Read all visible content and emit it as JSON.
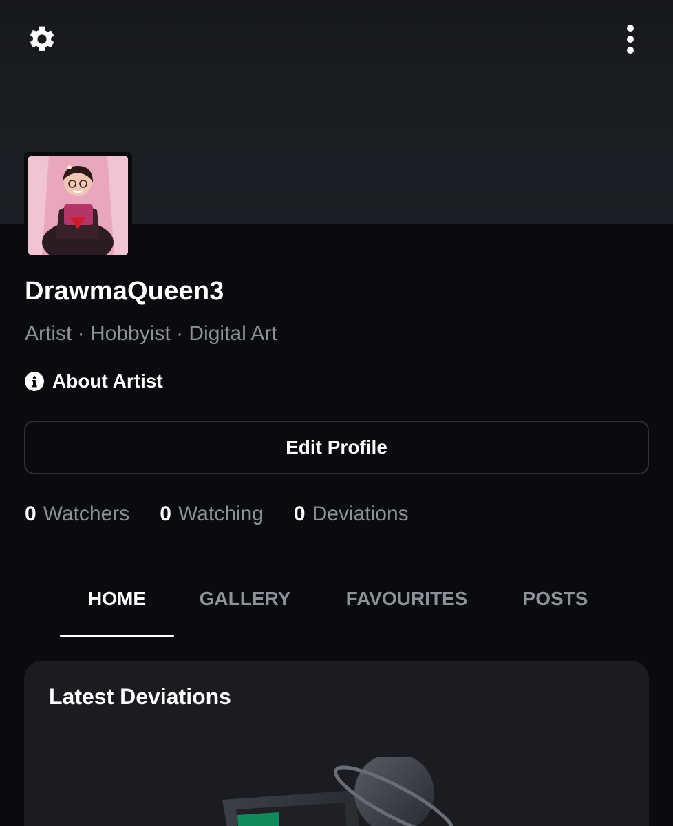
{
  "profile": {
    "username": "DrawmaQueen3",
    "tagline": "Artist · Hobbyist · Digital Art",
    "about_label": "About Artist",
    "edit_label": "Edit Profile"
  },
  "stats": [
    {
      "count": "0",
      "label": "Watchers"
    },
    {
      "count": "0",
      "label": "Watching"
    },
    {
      "count": "0",
      "label": "Deviations"
    }
  ],
  "tabs": [
    {
      "label": "HOME",
      "active": true
    },
    {
      "label": "GALLERY",
      "active": false
    },
    {
      "label": "FAVOURITES",
      "active": false
    },
    {
      "label": "POSTS",
      "active": false
    }
  ],
  "latest": {
    "title": "Latest Deviations"
  },
  "icons": {
    "settings": "gear-icon",
    "more": "more-vertical-icon",
    "info": "info-icon"
  },
  "colors": {
    "background": "#0a0b0e",
    "banner": "#1a1d22",
    "muted_text": "#8e9199",
    "card": "#1a1c21",
    "border": "#2e3036"
  }
}
